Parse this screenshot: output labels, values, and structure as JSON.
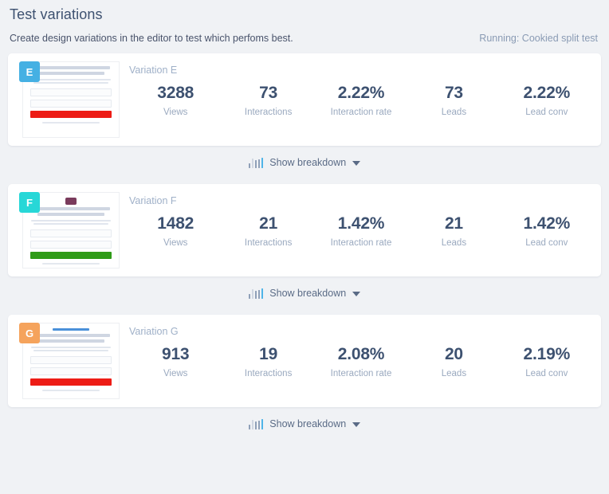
{
  "header": {
    "title": "Test variations",
    "subtitle": "Create design variations in the editor to test which perfoms best.",
    "status": "Running: Cookied split test"
  },
  "breakdown": {
    "label": "Show breakdown",
    "chart_icon": "bar-chart-icon",
    "caret_icon": "chevron-down-icon"
  },
  "colors": {
    "badge_e": "#45b0e3",
    "badge_f": "#27d7d7",
    "badge_g": "#f5a35c",
    "cta_e": "#ed1c16",
    "cta_f": "#2f9b18",
    "cta_g": "#ed1c16",
    "topbar_g": "#4a90d9",
    "logo_f": "#7a3b5c",
    "page_bg": "#f0f2f5",
    "card_bg": "#ffffff",
    "text_primary": "#3d5170",
    "text_muted": "#9aa9bf"
  },
  "metric_labels": [
    "Views",
    "Interactions",
    "Interaction rate",
    "Leads",
    "Lead conv"
  ],
  "variations": [
    {
      "badge": "E",
      "badge_color": "#45b0e3",
      "label": "Variation E",
      "thumb": {
        "cta_color": "#ed1c16",
        "has_logo": false,
        "has_topbar": false,
        "topbar_color": ""
      },
      "metrics": {
        "views": "3288",
        "interactions": "73",
        "interaction_rate": "2.22%",
        "leads": "73",
        "lead_conv": "2.22%"
      }
    },
    {
      "badge": "F",
      "badge_color": "#27d7d7",
      "label": "Variation F",
      "thumb": {
        "cta_color": "#2f9b18",
        "has_logo": true,
        "has_topbar": false,
        "topbar_color": ""
      },
      "metrics": {
        "views": "1482",
        "interactions": "21",
        "interaction_rate": "1.42%",
        "leads": "21",
        "lead_conv": "1.42%"
      }
    },
    {
      "badge": "G",
      "badge_color": "#f5a35c",
      "label": "Variation G",
      "thumb": {
        "cta_color": "#ed1c16",
        "has_logo": false,
        "has_topbar": true,
        "topbar_color": "#4a90d9"
      },
      "metrics": {
        "views": "913",
        "interactions": "19",
        "interaction_rate": "2.08%",
        "leads": "20",
        "lead_conv": "2.19%"
      }
    }
  ]
}
